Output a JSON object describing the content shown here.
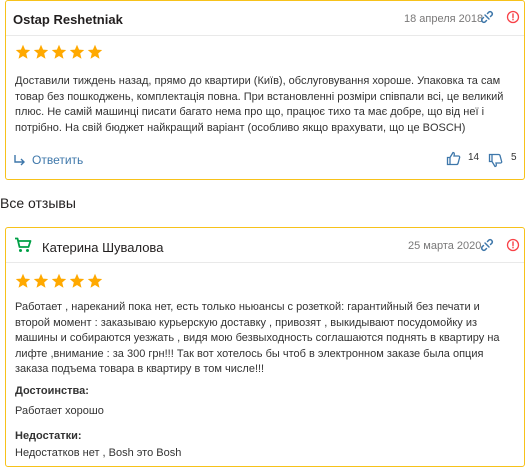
{
  "colors": {
    "accent": "#f7c21a",
    "star": "#ffa900",
    "link": "#3e77aa",
    "avatar": "#00a046",
    "red": "#f84147"
  },
  "review1": {
    "author": "Ostap Reshetniak",
    "date": "18 апреля 2018",
    "rating": 5,
    "text": "Доставили тиждень назад, прямо до квартири (Київ), обслуговування хороше. Упаковка та сам товар без пошкоджень, комплектація повна. При встановленні розміри співпали всі, це великий плюс. Не самій машинці писати багато нема про що, працює тихо та має добре, що від неї і потрібно. На свій бюджет найкращий варіант (особливо якщо врахувати, що це BOSCH)",
    "reply_label": "Ответить",
    "likes": "14",
    "dislikes": "5"
  },
  "section_title": "Все отзывы",
  "review2": {
    "author": "Катерина Шувалова",
    "date": "25 марта 2020",
    "rating": 5,
    "text": "Работает , нареканий пока нет, есть только ньюансы с розеткой: гарантийный без печати и второй момент : заказываю курьерскую доставку , привозят , выкидывают посудомойку из машины и собираются уезжать , видя мою безвыходность соглашаются поднять в квартиру на лифте ,внимание : за 300 грн!!! Так вот хотелось бы чтоб в электронном заказе была опция заказа подъема товара в квартиру в том числе!!!",
    "pros_label": "Достоинства:",
    "pros_text": "Работает хорошо",
    "cons_label": "Недостатки:",
    "cons_text": "Недостатков нет , Bosh это Bosh"
  }
}
